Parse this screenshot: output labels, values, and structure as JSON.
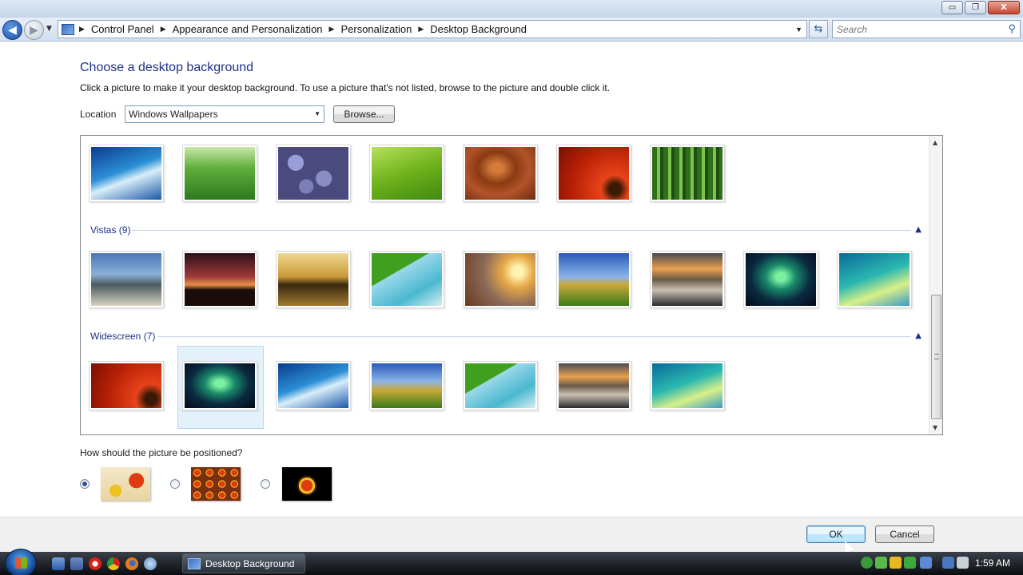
{
  "window": {
    "minimize": "▭",
    "maximize": "❐",
    "close": "X"
  },
  "address": {
    "crumbs": [
      "Control Panel",
      "Appearance and Personalization",
      "Personalization",
      "Desktop Background"
    ],
    "search_placeholder": "Search"
  },
  "page": {
    "title": "Choose a desktop background",
    "instructions": "Click a picture to make it your desktop background. To use a picture that's not listed, browse to the picture and double click it.",
    "location_label": "Location",
    "location_value": "Windows Wallpapers",
    "browse_label": "Browse..."
  },
  "gallery": {
    "groups": [
      {
        "name": "Vistas (9)",
        "count": 9
      },
      {
        "name": "Widescreen (7)",
        "count": 7
      }
    ],
    "top_row_thumbs": [
      "fish",
      "grass",
      "stones",
      "leaf",
      "wood",
      "red-flower",
      "bamboo"
    ],
    "vistas_thumbs": [
      "mountain-lake",
      "sunset-hills",
      "golden-rocks",
      "palm-frond",
      "field-sunset",
      "green-hills",
      "canyon-reflection",
      "aurora",
      "vista-aurora-green"
    ],
    "widescreen_thumbs": [
      "red-flower",
      "aurora",
      "fish",
      "green-hills",
      "palm-frond",
      "canyon-reflection",
      "vista-aurora-green"
    ],
    "selected": "widescreen-aurora"
  },
  "position": {
    "label": "How should the picture be positioned?",
    "options": [
      "fit-to-screen",
      "tile",
      "center"
    ],
    "selected": "fit-to-screen"
  },
  "buttons": {
    "ok": "OK",
    "cancel": "Cancel"
  },
  "taskbar": {
    "active_window": "Desktop Background",
    "clock": "1:59 AM"
  }
}
